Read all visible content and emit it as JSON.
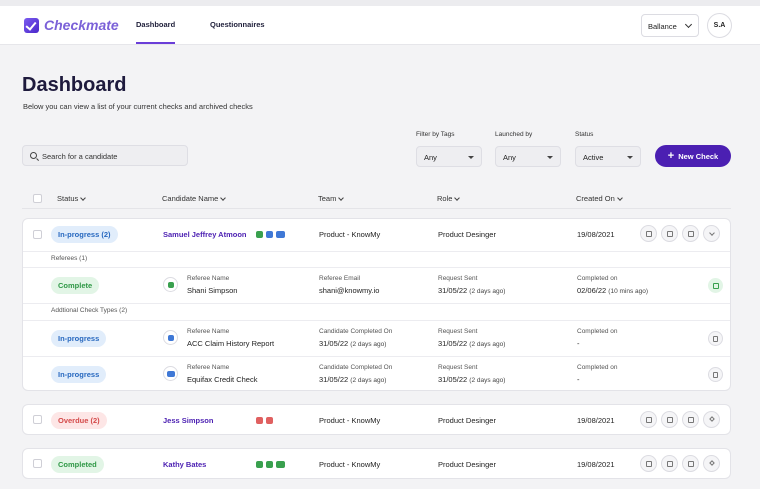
{
  "app": {
    "name": "Checkmate"
  },
  "nav": {
    "tabs": [
      {
        "label": "Dashboard",
        "active": true
      },
      {
        "label": "Questionnaires",
        "active": false
      }
    ]
  },
  "header": {
    "tenant": "Ballance",
    "avatar": "S.A"
  },
  "page": {
    "title": "Dashboard",
    "subtitle": "Below you can view a list of your current checks and archived checks"
  },
  "search": {
    "placeholder": "Search for a candidate"
  },
  "filters": {
    "tags": {
      "label": "Filter by Tags",
      "value": "Any"
    },
    "launched": {
      "label": "Launched by",
      "value": "Any"
    },
    "status": {
      "label": "Status",
      "value": "Active"
    }
  },
  "new_check_label": "New Check",
  "columns": [
    "Status",
    "Candidate Name",
    "Team",
    "Role",
    "Created On"
  ],
  "rows": [
    {
      "status": "In-progress (2)",
      "name": "Samuel Jeffrey Atmoon",
      "team": "Product - KnowMy",
      "role": "Product Desinger",
      "created": "19/08/2021"
    },
    {
      "status": "Overdue (2)",
      "name": "Jess Simpson",
      "team": "Product - KnowMy",
      "role": "Product Desinger",
      "created": "19/08/2021"
    },
    {
      "status": "Completed",
      "name": "Kathy Bates",
      "team": "Product - KnowMy",
      "role": "Product Desinger",
      "created": "19/08/2021"
    }
  ],
  "expanded": {
    "referees_header": "Referees (1)",
    "additional_header": "Addtional Check Types (2)",
    "referee": {
      "status": "Complete",
      "name_label": "Referee Name",
      "name": "Shani Simpson",
      "email_label": "Referee Email",
      "email": "shani@knowmy.io",
      "sent_label": "Request Sent",
      "sent": "31/05/22",
      "sent_ago": "(2 days ago)",
      "done_label": "Completed on",
      "done": "02/06/22",
      "done_ago": "(10 mins ago)"
    },
    "checks": [
      {
        "status": "In-progress",
        "name_label": "Referee Name",
        "name": "ACC Claim History Report",
        "cand_label": "Candidate Completed On",
        "cand": "31/05/22",
        "cand_ago": "(2 days ago)",
        "sent_label": "Request Sent",
        "sent": "31/05/22",
        "sent_ago": "(2 days ago)",
        "done_label": "Completed on",
        "done": "-"
      },
      {
        "status": "In-progress",
        "name_label": "Referee Name",
        "name": "Equifax Credit Check",
        "cand_label": "Candidate Completed On",
        "cand": "31/05/22",
        "cand_ago": "(2 days ago)",
        "sent_label": "Request Sent",
        "sent": "31/05/22",
        "sent_ago": "(2 days ago)",
        "done_label": "Completed on",
        "done": "-"
      }
    ]
  },
  "colors": {
    "accent": "#4b1fb2",
    "progress": "#2768bf",
    "overdue": "#d44a4a",
    "complete": "#2f9846"
  }
}
